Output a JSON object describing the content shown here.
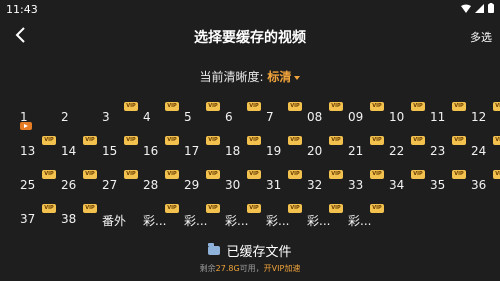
{
  "status": {
    "time": "11:43"
  },
  "header": {
    "title": "选择要缓存的视频",
    "multi_select": "多选"
  },
  "quality": {
    "label": "当前清晰度:",
    "value": "标清"
  },
  "episodes": [
    {
      "label": "1",
      "vip": false,
      "playing": true
    },
    {
      "label": "2",
      "vip": false
    },
    {
      "label": "3",
      "vip": true
    },
    {
      "label": "4",
      "vip": true
    },
    {
      "label": "5",
      "vip": true
    },
    {
      "label": "6",
      "vip": true
    },
    {
      "label": "7",
      "vip": true
    },
    {
      "label": "08",
      "vip": true
    },
    {
      "label": "09",
      "vip": true
    },
    {
      "label": "10",
      "vip": true
    },
    {
      "label": "11",
      "vip": true
    },
    {
      "label": "12",
      "vip": true
    },
    {
      "label": "13",
      "vip": true
    },
    {
      "label": "14",
      "vip": true
    },
    {
      "label": "15",
      "vip": true
    },
    {
      "label": "16",
      "vip": true
    },
    {
      "label": "17",
      "vip": true
    },
    {
      "label": "18",
      "vip": true
    },
    {
      "label": "19",
      "vip": true
    },
    {
      "label": "20",
      "vip": true
    },
    {
      "label": "21",
      "vip": true
    },
    {
      "label": "22",
      "vip": true
    },
    {
      "label": "23",
      "vip": true
    },
    {
      "label": "24",
      "vip": true
    },
    {
      "label": "25",
      "vip": true
    },
    {
      "label": "26",
      "vip": true
    },
    {
      "label": "27",
      "vip": true
    },
    {
      "label": "28",
      "vip": true
    },
    {
      "label": "29",
      "vip": true
    },
    {
      "label": "30",
      "vip": true
    },
    {
      "label": "31",
      "vip": true
    },
    {
      "label": "32",
      "vip": true
    },
    {
      "label": "33",
      "vip": true
    },
    {
      "label": "34",
      "vip": true
    },
    {
      "label": "35",
      "vip": true
    },
    {
      "label": "36",
      "vip": true
    },
    {
      "label": "37",
      "vip": true
    },
    {
      "label": "38",
      "vip": true
    },
    {
      "label": "番外",
      "vip": false
    },
    {
      "label": "彩...",
      "vip": true
    },
    {
      "label": "彩...",
      "vip": true
    },
    {
      "label": "彩...",
      "vip": true
    },
    {
      "label": "彩...",
      "vip": true
    },
    {
      "label": "彩...",
      "vip": true
    },
    {
      "label": "彩...",
      "vip": true
    }
  ],
  "vip_badge": "VIP",
  "cached": {
    "label": "已缓存文件"
  },
  "storage": {
    "prefix": "剩余",
    "amount": "27.8G",
    "middle": "可用，",
    "link": "开VIP加速"
  }
}
